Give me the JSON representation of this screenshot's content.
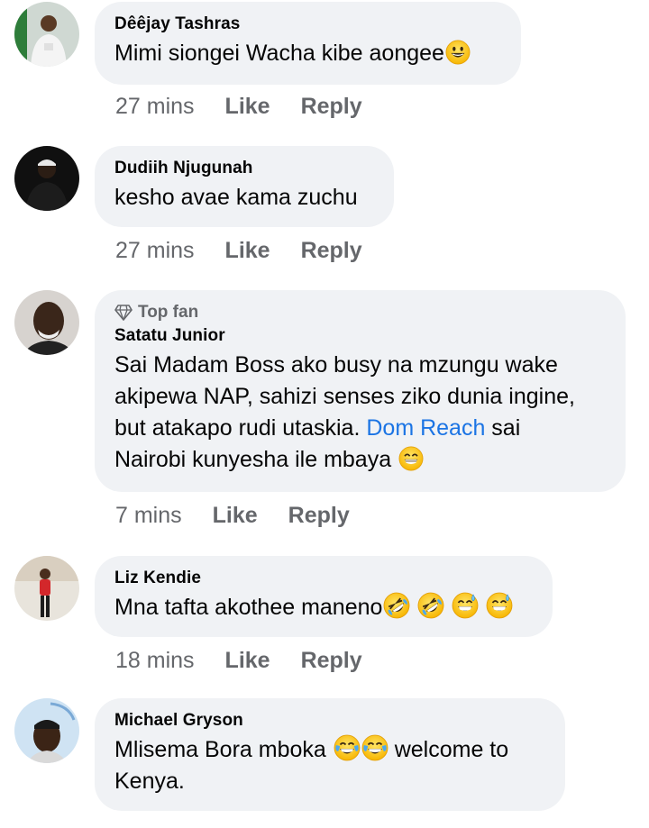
{
  "comments": [
    {
      "author": "Dêêjay Tashras",
      "text": "Mimi siongei Wacha kibe aongee",
      "time": "27 mins",
      "emojis": [
        "grin"
      ]
    },
    {
      "author": "Dudiih Njugunah",
      "text": "kesho avae kama zuchu",
      "time": "27 mins",
      "emojis": []
    },
    {
      "badge": "Top fan",
      "badge_icon": "diamond-icon",
      "author": "Satatu Junior",
      "text_lines": [
        "Sai Madam Boss ako busy na mzungu wake",
        "akipewa NAP, sahizi senses ziko dunia ingine,",
        "but atakapo rudi utaskia."
      ],
      "mention": "Dom Reach",
      "after_mention": " sai",
      "last_line": "Nairobi kunyesha ile mbaya",
      "time": "7 mins",
      "emojis": [
        "beaming"
      ]
    },
    {
      "author": "Liz Kendie",
      "text": "Mna tafta akothee maneno",
      "time": "18 mins",
      "emojis": [
        "rofl",
        "rofl",
        "sweat-smile",
        "sweat-smile"
      ]
    },
    {
      "author": "Michael Gryson",
      "text_before": "Mlisema Bora mboka",
      "text_after": "welcome to",
      "last_line": "Kenya.",
      "emojis": [
        "joy",
        "joy"
      ]
    }
  ],
  "actions": {
    "like": "Like",
    "reply": "Reply"
  },
  "colors": {
    "bubble": "#f0f2f5",
    "meta": "#65676b",
    "mention": "#1b74e4",
    "text": "#050505"
  }
}
